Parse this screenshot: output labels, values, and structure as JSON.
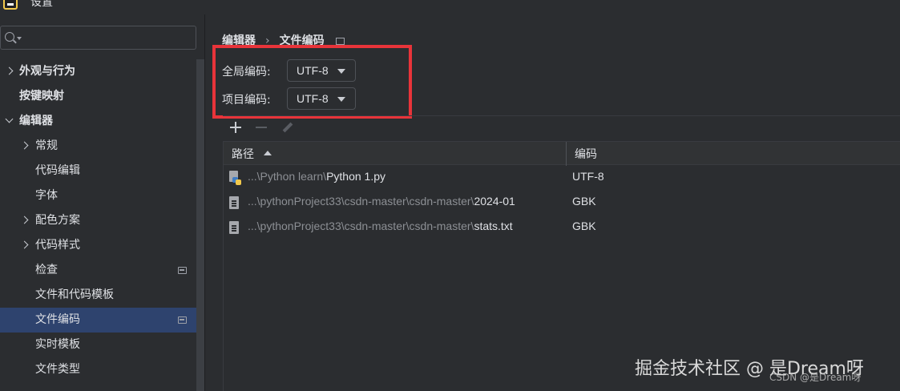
{
  "window": {
    "title": "设置"
  },
  "sidebar": {
    "search_placeholder": "",
    "items": [
      {
        "label": "外观与行为",
        "expander": "collapsed",
        "bold": true,
        "indent": 0
      },
      {
        "label": "按键映射",
        "expander": "none",
        "bold": true,
        "indent": 0
      },
      {
        "label": "编辑器",
        "expander": "expanded",
        "bold": true,
        "indent": 0
      },
      {
        "label": "常规",
        "expander": "collapsed",
        "bold": false,
        "indent": 1
      },
      {
        "label": "代码编辑",
        "expander": "none",
        "bold": false,
        "indent": 1
      },
      {
        "label": "字体",
        "expander": "none",
        "bold": false,
        "indent": 1
      },
      {
        "label": "配色方案",
        "expander": "collapsed",
        "bold": false,
        "indent": 1
      },
      {
        "label": "代码样式",
        "expander": "collapsed",
        "bold": false,
        "indent": 1
      },
      {
        "label": "检查",
        "expander": "none",
        "bold": false,
        "indent": 1,
        "page_icon": true
      },
      {
        "label": "文件和代码模板",
        "expander": "none",
        "bold": false,
        "indent": 1
      },
      {
        "label": "文件编码",
        "expander": "none",
        "bold": false,
        "indent": 1,
        "page_icon": true,
        "selected": true
      },
      {
        "label": "实时模板",
        "expander": "none",
        "bold": false,
        "indent": 1
      },
      {
        "label": "文件类型",
        "expander": "none",
        "bold": false,
        "indent": 1
      }
    ]
  },
  "breadcrumb": {
    "parent": "编辑器",
    "separator": "›",
    "current": "文件编码"
  },
  "encoding": {
    "global": {
      "label": "全局编码:",
      "value": "UTF-8"
    },
    "project": {
      "label": "项目编码:",
      "value": "UTF-8"
    }
  },
  "table": {
    "columns": {
      "path": "路径",
      "encoding": "编码"
    },
    "rows": [
      {
        "icon": "python-file-icon",
        "path_prefix": "...\\Python learn\\",
        "path_name": "Python 1.py",
        "encoding": "UTF-8"
      },
      {
        "icon": "text-file-icon",
        "path_prefix": "...\\pythonProject33\\csdn-master\\csdn-master\\",
        "path_name": "2024-01",
        "encoding": "GBK"
      },
      {
        "icon": "text-file-icon",
        "path_prefix": "...\\pythonProject33\\csdn-master\\csdn-master\\",
        "path_name": "stats.txt",
        "encoding": "GBK"
      }
    ]
  },
  "watermark": {
    "main": "掘金技术社区 @ 是Dream呀",
    "small": "CSDN @是Dream呀"
  },
  "colors": {
    "accent_selected": "#2e436e",
    "highlight_box": "#e8343a",
    "background": "#2b2d30"
  }
}
